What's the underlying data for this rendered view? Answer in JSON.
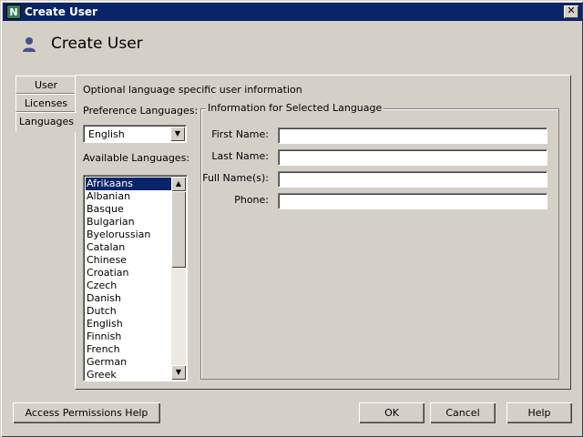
{
  "window": {
    "title": "Create User",
    "app_icon_letter": "N",
    "close_label": "✕"
  },
  "header": {
    "title": "Create User",
    "icon": "user-icon"
  },
  "tabs": [
    {
      "label": "User",
      "active": false
    },
    {
      "label": "Licenses",
      "active": false
    },
    {
      "label": "Languages",
      "active": true
    }
  ],
  "panel": {
    "description": "Optional language specific user information",
    "preference_label": "Preference Languages:",
    "preference_selected": "English",
    "available_label": "Available Languages:",
    "available_languages": [
      "Afrikaans",
      "Albanian",
      "Basque",
      "Bulgarian",
      "Byelorussian",
      "Catalan",
      "Chinese",
      "Croatian",
      "Czech",
      "Danish",
      "Dutch",
      "English",
      "Finnish",
      "French",
      "German",
      "Greek"
    ],
    "selected_language": "Afrikaans",
    "group_title": "Information for Selected Language",
    "fields": {
      "first_name_label": "First Name:",
      "first_name_value": "",
      "last_name_label": "Last Name:",
      "last_name_value": "",
      "full_name_label": "Full Name(s):",
      "full_name_value": "",
      "phone_label": "Phone:",
      "phone_value": ""
    }
  },
  "buttons": {
    "help_access": "Access Permissions Help",
    "ok": "OK",
    "cancel": "Cancel",
    "help": "Help"
  },
  "colors": {
    "titlebar": "#0a246a",
    "selection": "#0a246a",
    "face": "#d4d0c8",
    "user_icon": "#4a4f8a"
  }
}
